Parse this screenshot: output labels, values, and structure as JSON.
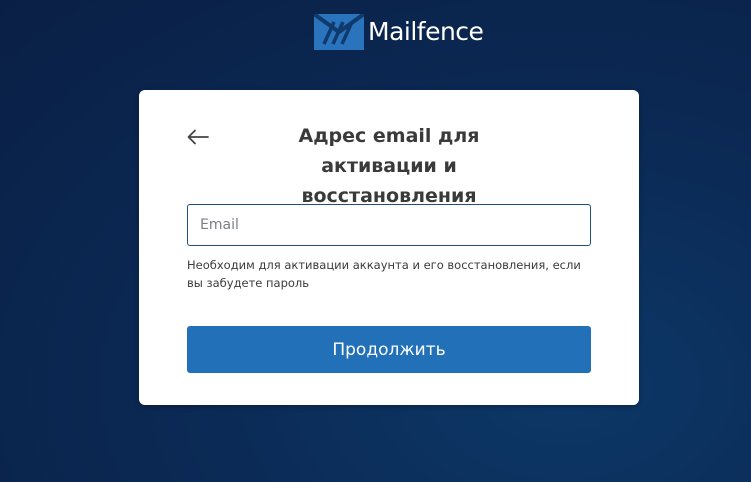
{
  "brand": {
    "logo_icon": "mailfence-logo-icon",
    "name": "Mailfence",
    "accent_color": "#2170b8"
  },
  "form": {
    "back_icon": "arrow-left-icon",
    "title": "Адрес email для активации и восстановления",
    "email": {
      "placeholder": "Email",
      "value": ""
    },
    "hint": "Необходим для активации аккаунта и его восстановления, если вы забудете пароль",
    "continue_label": "Продолжить"
  }
}
